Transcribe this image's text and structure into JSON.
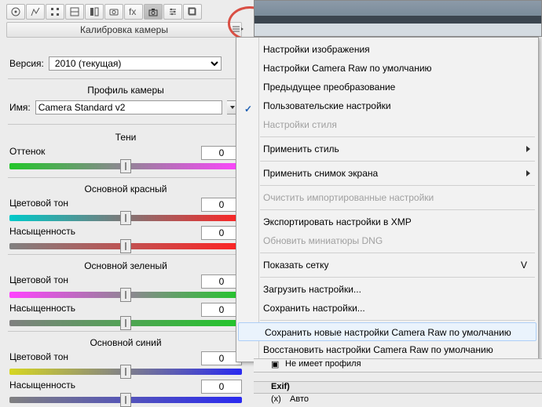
{
  "toolbar": {
    "icons": [
      "target",
      "levels",
      "curves",
      "sharpen",
      "grayscale",
      "splittone",
      "fx",
      "lens",
      "camera",
      "sliders",
      "presets"
    ]
  },
  "panel": {
    "title": "Калибровка камеры",
    "version_label": "Версия:",
    "version_value": "2010 (текущая)",
    "profile_title": "Профиль камеры",
    "name_label": "Имя:",
    "name_value": "Camera Standard v2",
    "groups": {
      "shadows": "Тени",
      "red": "Основной красный",
      "green": "Основной зеленый",
      "blue": "Основной синий"
    },
    "labels": {
      "tint": "Оттенок",
      "hue": "Цветовой тон",
      "sat": "Насыщенность"
    },
    "zero": "0"
  },
  "menu": {
    "image_settings": "Настройки изображения",
    "cr_defaults": "Настройки Camera Raw  по умолчанию",
    "prev_transform": "Предыдущее преобразование",
    "user_settings": "Пользовательские настройки",
    "style_settings": "Настройки стиля",
    "apply_style": "Применить стиль",
    "apply_snapshot": "Применить снимок экрана",
    "clear_imported": "Очистить импортированные настройки",
    "export_xmp": "Экспортировать настройки в XMP",
    "update_dng": "Обновить миниатюры DNG",
    "show_grid": "Показать сетку",
    "show_grid_key": "V",
    "load_settings": "Загрузить настройки...",
    "save_settings": "Сохранить настройки...",
    "save_new_defaults": "Сохранить новые настройки Camera Raw по умолчанию",
    "restore_defaults": "Восстановить настройки Camera Raw по умолчанию"
  },
  "below": {
    "no_profile": "Не имеет профиля",
    "exif": "Exif)",
    "flash": "(x)",
    "auto": "Авто"
  }
}
